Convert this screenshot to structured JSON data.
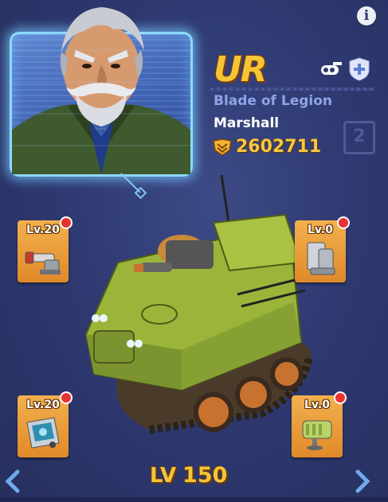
{
  "info_icon": "ⓘ info-icon",
  "info_glyph": "i",
  "hero": {
    "rank": "UR",
    "subtitle": "Blade of Legion",
    "name": "Marshall",
    "power": "2602711",
    "slot_number": "2"
  },
  "equipment": {
    "top_left": {
      "level": "Lv.20",
      "icon": "cannon-icon",
      "has_alert": true
    },
    "top_right": {
      "level": "Lv.0",
      "icon": "armor-plate-icon",
      "has_alert": true
    },
    "bottom_left": {
      "level": "Lv.20",
      "icon": "radar-icon",
      "has_alert": true
    },
    "bottom_right": {
      "level": "Lv.0",
      "icon": "engine-icon",
      "has_alert": true
    }
  },
  "level": {
    "label": "LV",
    "value": "150"
  },
  "colors": {
    "background": "#2f3a72",
    "gold": "#f6c536",
    "slot_orange": "#f0a646",
    "tank_green": "#9ab53a",
    "subtitle_blue": "#8fa4e8",
    "alert_red": "#e8322f"
  }
}
